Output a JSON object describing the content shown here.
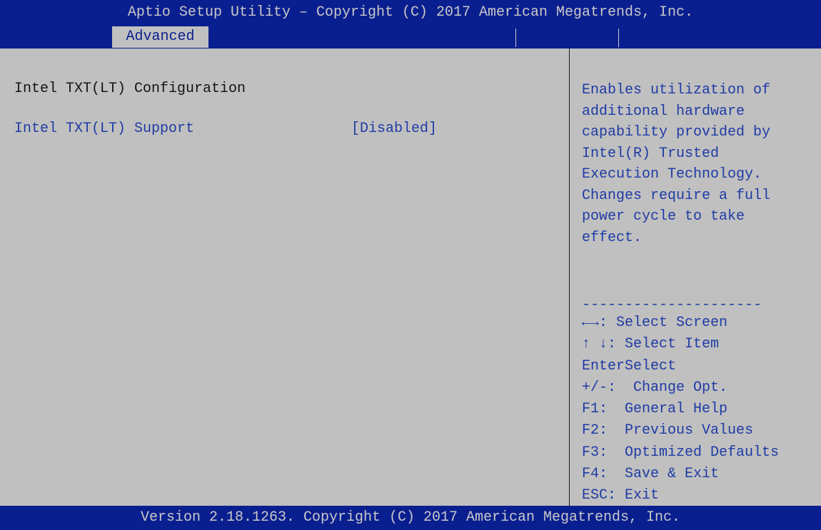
{
  "title": "Aptio Setup Utility – Copyright (C) 2017 American Megatrends, Inc.",
  "tabs": [
    {
      "label": "Advanced",
      "selected": true
    }
  ],
  "main": {
    "section_title": "Intel TXT(LT) Configuration",
    "settings": [
      {
        "label": "Intel TXT(LT) Support",
        "value": "[Disabled]"
      }
    ]
  },
  "help": {
    "description": "Enables utilization of\nadditional hardware\ncapability provided by\nIntel(R) Trusted\nExecution Technology.\nChanges require a full\npower cycle to take\neffect.",
    "separator": "---------------------",
    "keys": [
      "←→: Select Screen",
      "↑ ↓: Select Item",
      "EnterSelect",
      "+/-:  Change Opt.",
      "F1:  General Help",
      "F2:  Previous Values",
      "F3:  Optimized Defaults",
      "F4:  Save & Exit",
      "ESC: Exit"
    ]
  },
  "footer": "Version 2.18.1263. Copyright (C) 2017 American Megatrends, Inc.",
  "colors": {
    "bar_blue": "#0a1f8f",
    "panel_gray": "#c0c0c0",
    "highlight_text": "#1f3ba5",
    "normal_text": "#141414"
  }
}
